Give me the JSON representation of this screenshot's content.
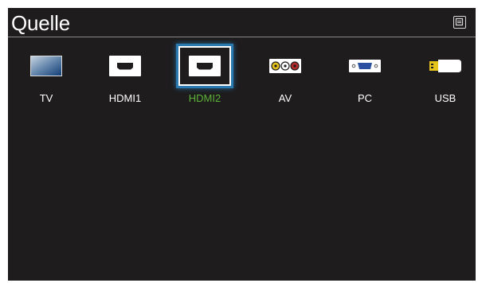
{
  "header": {
    "title": "Quelle"
  },
  "sources": [
    {
      "label": "TV",
      "icon": "tv-icon"
    },
    {
      "label": "HDMI1",
      "icon": "hdmi-port-icon"
    },
    {
      "label": "HDMI2",
      "icon": "hdmi-port-icon",
      "selected": true
    },
    {
      "label": "AV",
      "icon": "av-rca-icon"
    },
    {
      "label": "PC",
      "icon": "vga-port-icon"
    },
    {
      "label": "USB",
      "icon": "usb-drive-icon"
    }
  ],
  "colors": {
    "background": "#1e1c1d",
    "selected_label": "#5cb338",
    "focus_glow": "#2a7ab0"
  }
}
